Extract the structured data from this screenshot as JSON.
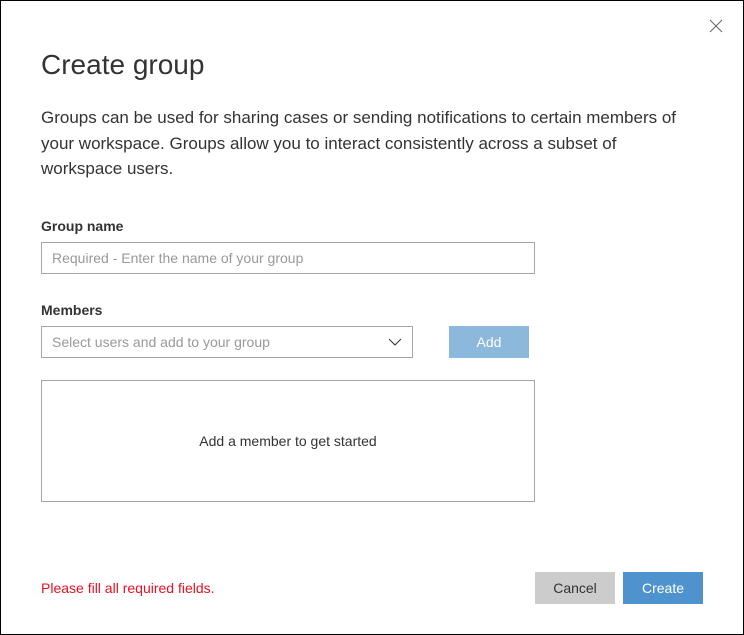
{
  "dialog": {
    "title": "Create group",
    "description": "Groups can be used for sharing cases or sending notifications to certain members of your workspace. Groups allow you to interact consistently across a subset of workspace users."
  },
  "fields": {
    "groupName": {
      "label": "Group name",
      "placeholder": "Required - Enter the name of your group",
      "value": ""
    },
    "members": {
      "label": "Members",
      "selectPlaceholder": "Select users and add to your group",
      "addButton": "Add",
      "emptyMessage": "Add a member to get started"
    }
  },
  "footer": {
    "errorMessage": "Please fill all required fields.",
    "cancelButton": "Cancel",
    "createButton": "Create"
  }
}
